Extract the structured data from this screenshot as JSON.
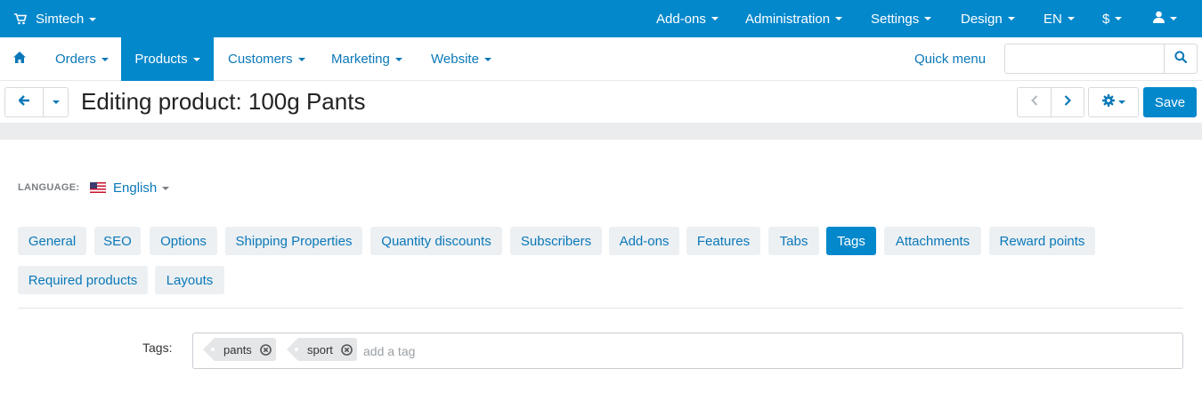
{
  "topbar": {
    "brand": "Simtech",
    "menu": [
      "Add-ons",
      "Administration",
      "Settings",
      "Design",
      "EN",
      "$"
    ],
    "icons": {
      "cart": "cart-icon",
      "user": "user-icon"
    },
    "color": "#0388cc"
  },
  "navbar": {
    "items": [
      "Orders",
      "Products",
      "Customers",
      "Marketing",
      "Website"
    ],
    "active": "Products",
    "quick_menu": "Quick menu",
    "search": {
      "placeholder": "",
      "value": ""
    }
  },
  "titlebar": {
    "title": "Editing product: 100g Pants",
    "save_label": "Save"
  },
  "language": {
    "label": "LANGUAGE:",
    "value": "English"
  },
  "tabs": {
    "row1": [
      "General",
      "SEO",
      "Options",
      "Shipping Properties",
      "Quantity discounts",
      "Subscribers",
      "Add-ons",
      "Features",
      "Tabs",
      "Tags",
      "Attachments",
      "Reward points"
    ],
    "row2": [
      "Required products",
      "Layouts"
    ],
    "active": "Tags"
  },
  "tags_field": {
    "label": "Tags:",
    "tags": [
      "pants",
      "sport"
    ],
    "placeholder": "add a tag"
  }
}
